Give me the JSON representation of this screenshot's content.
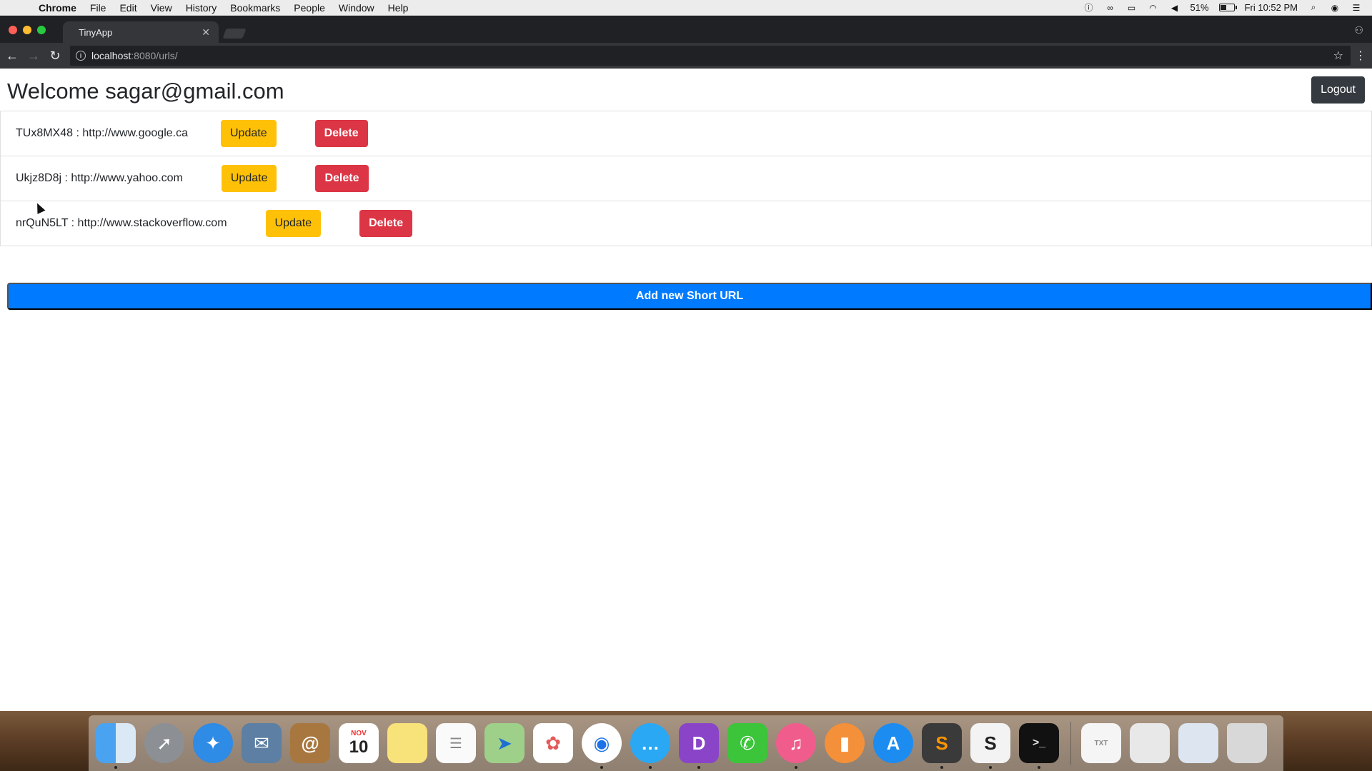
{
  "menubar": {
    "app_name": "Chrome",
    "items": [
      "File",
      "Edit",
      "View",
      "History",
      "Bookmarks",
      "People",
      "Window",
      "Help"
    ],
    "battery_percent": "51%",
    "battery_level": 0.51,
    "clock": "Fri 10:52 PM"
  },
  "browser": {
    "tab_title": "TinyApp",
    "url_host": "localhost",
    "url_path": ":8080/urls/"
  },
  "page": {
    "title": "Welcome sagar@gmail.com",
    "logout_label": "Logout",
    "urls": [
      {
        "text": "TUx8MX48 : http://www.google.ca",
        "update_label": "Update",
        "delete_label": "Delete"
      },
      {
        "text": "Ukjz8D8j : http://www.yahoo.com",
        "update_label": "Update",
        "delete_label": "Delete"
      },
      {
        "text": "nrQuN5LT : http://www.stackoverflow.com",
        "update_label": "Update",
        "delete_label": "Delete"
      }
    ],
    "add_label": "Add new Short URL"
  },
  "dock": {
    "calendar_month": "NOV",
    "calendar_day": "10",
    "apps": [
      "finder",
      "launchpad",
      "safari",
      "mail",
      "contacts",
      "calendar",
      "notes",
      "reminders",
      "maps",
      "photos",
      "chrome",
      "messages",
      "dash",
      "facetime",
      "itunes",
      "ibooks",
      "app-store",
      "sublime-text",
      "slack",
      "terminal"
    ],
    "documents": [
      "txt-file",
      "document-stack",
      "downloads",
      "trash"
    ]
  },
  "colors": {
    "update": "#ffc107",
    "delete": "#dc3545",
    "primary": "#007bff",
    "logout": "#343a40"
  }
}
